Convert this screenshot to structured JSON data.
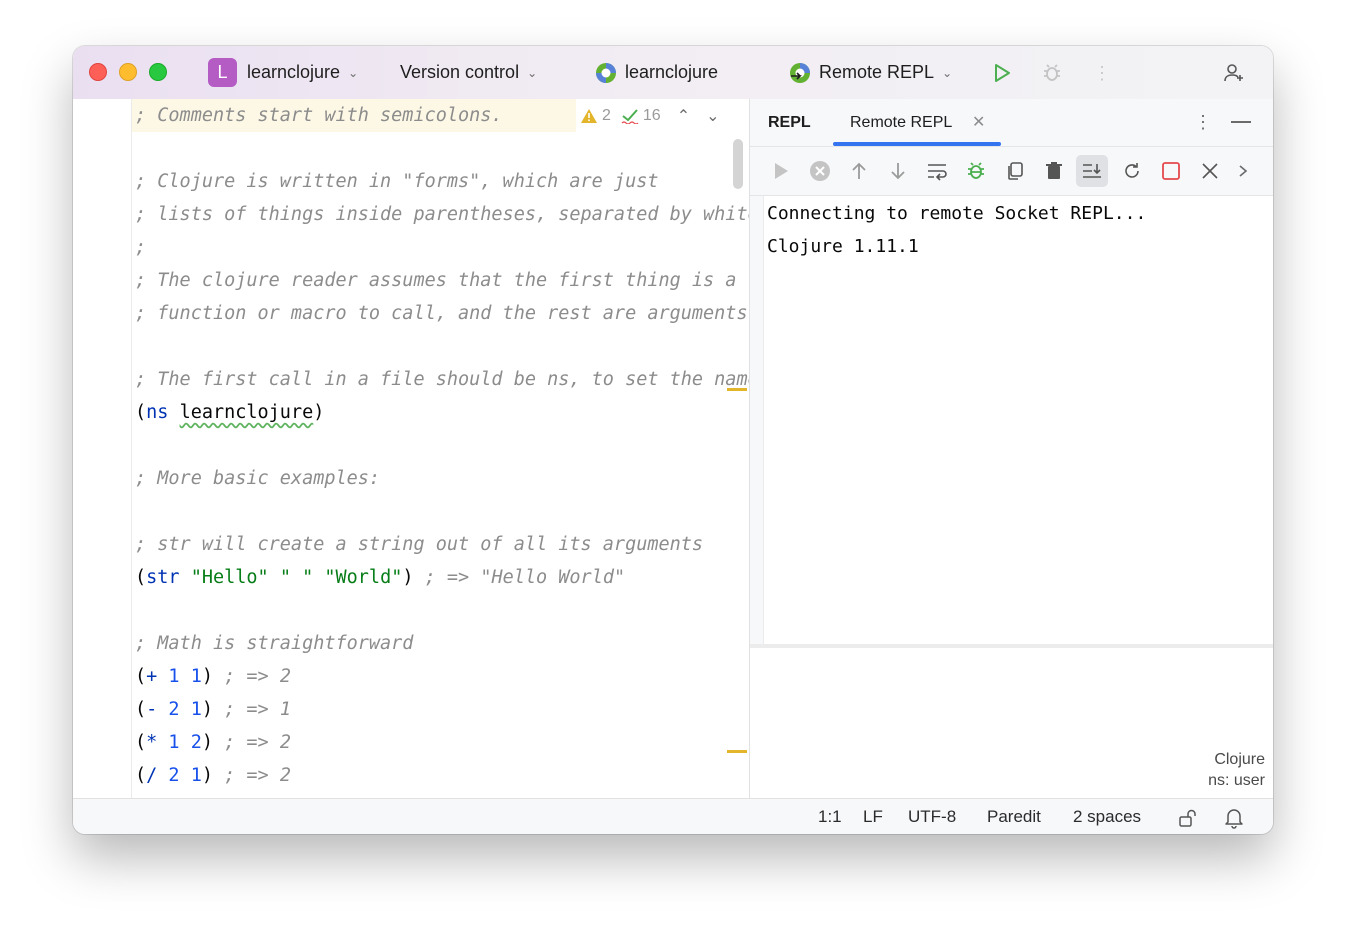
{
  "window": {
    "project_initial": "L",
    "project_name": "learnclojure",
    "vcs_label": "Version control",
    "module_name": "learnclojure",
    "run_config": "Remote REPL"
  },
  "editor": {
    "inspections": {
      "warnings": "2",
      "ok": "16"
    },
    "lines": [
      "; Comments start with semicolons.",
      "",
      "; Clojure is written in \"forms\", which are just",
      "; lists of things inside parentheses, separated by whitespace.",
      ";",
      "; The clojure reader assumes that the first thing is a",
      "; function or macro to call, and the rest are arguments.",
      "",
      "; The first call in a file should be ns, to set the namespace",
      "(ns learnclojure)",
      "",
      "; More basic examples:",
      "",
      "; str will create a string out of all its arguments",
      "(str \"Hello\" \" \" \"World\") ; => \"Hello World\"",
      "",
      "; Math is straightforward",
      "(+ 1 1) ; => 2",
      "(- 2 1) ; => 1",
      "(* 1 2) ; => 2",
      "(/ 2 1) ; => 2"
    ]
  },
  "panel": {
    "title": "REPL",
    "tab_label": "Remote REPL",
    "console_lines": [
      "Connecting to remote Socket REPL...",
      "Clojure 1.11.1"
    ],
    "language": "Clojure",
    "namespace": "ns: user"
  },
  "status": {
    "position": "1:1",
    "line_ending": "LF",
    "encoding": "UTF-8",
    "mode": "Paredit",
    "indent": "2 spaces"
  },
  "colors": {
    "accent": "#3574f0",
    "project_badge": "#b45cc4",
    "run_green": "#4caf50",
    "stop_red": "#e5484d"
  }
}
